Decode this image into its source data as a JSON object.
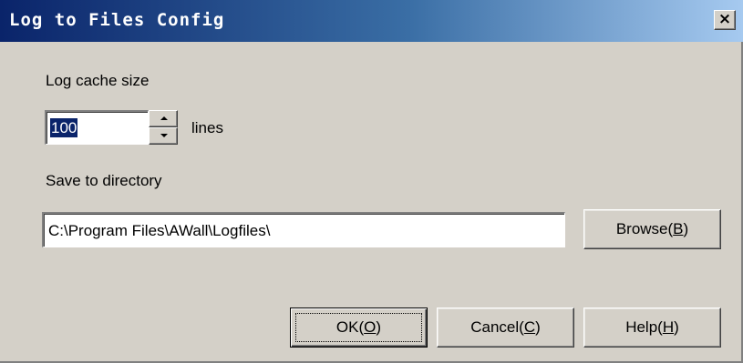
{
  "window": {
    "title": "Log to Files Config",
    "close_glyph": "✕"
  },
  "cache": {
    "label": "Log cache size",
    "value": "100",
    "unit": "lines",
    "spin_up_icon": "arrow-up-icon",
    "spin_down_icon": "arrow-down-icon"
  },
  "directory": {
    "label": "Save to directory",
    "value": "C:\\Program Files\\AWall\\Logfiles\\"
  },
  "buttons": {
    "browse": "Browse(B)",
    "ok": "OK(O)",
    "cancel": "Cancel(C)",
    "help": "Help(H)"
  },
  "colors": {
    "title_gradient_start": "#0a246a",
    "title_gradient_end": "#a6caf0",
    "face": "#d4d0c8",
    "selection": "#0a246a"
  }
}
